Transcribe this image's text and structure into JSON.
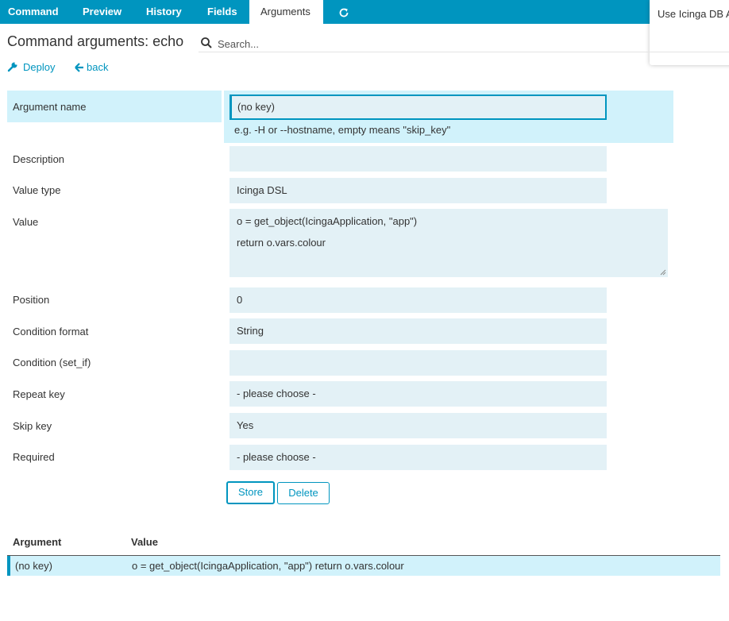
{
  "tabs": [
    {
      "label": "Command",
      "active": false
    },
    {
      "label": "Preview",
      "active": false
    },
    {
      "label": "History",
      "active": false
    },
    {
      "label": "Fields",
      "active": false
    },
    {
      "label": "Arguments",
      "active": true
    }
  ],
  "refresh_icon": "refresh-icon",
  "popup": {
    "text": "Use Icinga DB A"
  },
  "page_title": "Command arguments: echo",
  "search": {
    "placeholder": "Search...",
    "value": "",
    "icon": "search-icon"
  },
  "actions": {
    "deploy": {
      "label": "Deploy",
      "icon": "wrench-icon"
    },
    "back": {
      "label": "back",
      "icon": "arrow-left-icon"
    }
  },
  "form": {
    "argument_name": {
      "label": "Argument name",
      "value": "(no key)",
      "hint": "e.g. -H or --hostname, empty means \"skip_key\""
    },
    "description": {
      "label": "Description",
      "value": ""
    },
    "value_type": {
      "label": "Value type",
      "value": "Icinga DSL"
    },
    "value": {
      "label": "Value",
      "line1": "o = get_object(IcingaApplication, \"app\")",
      "line2": "return o.vars.colour"
    },
    "position": {
      "label": "Position",
      "value": "0"
    },
    "condition_format": {
      "label": "Condition format",
      "value": "String"
    },
    "condition_set_if": {
      "label": "Condition (set_if)",
      "value": ""
    },
    "repeat_key": {
      "label": "Repeat key",
      "value": "- please choose -"
    },
    "skip_key": {
      "label": "Skip key",
      "value": "Yes"
    },
    "required": {
      "label": "Required",
      "value": "- please choose -"
    }
  },
  "buttons": {
    "store": "Store",
    "delete": "Delete"
  },
  "table": {
    "headers": [
      "Argument",
      "Value"
    ],
    "rows": [
      {
        "argument": "(no key)",
        "value": "o = get_object(IcingaApplication, \"app\") return o.vars.colour"
      }
    ]
  },
  "colors": {
    "accent": "#0095bf",
    "highlight": "#d1f2fb",
    "field_bg": "#e3f1f6"
  }
}
